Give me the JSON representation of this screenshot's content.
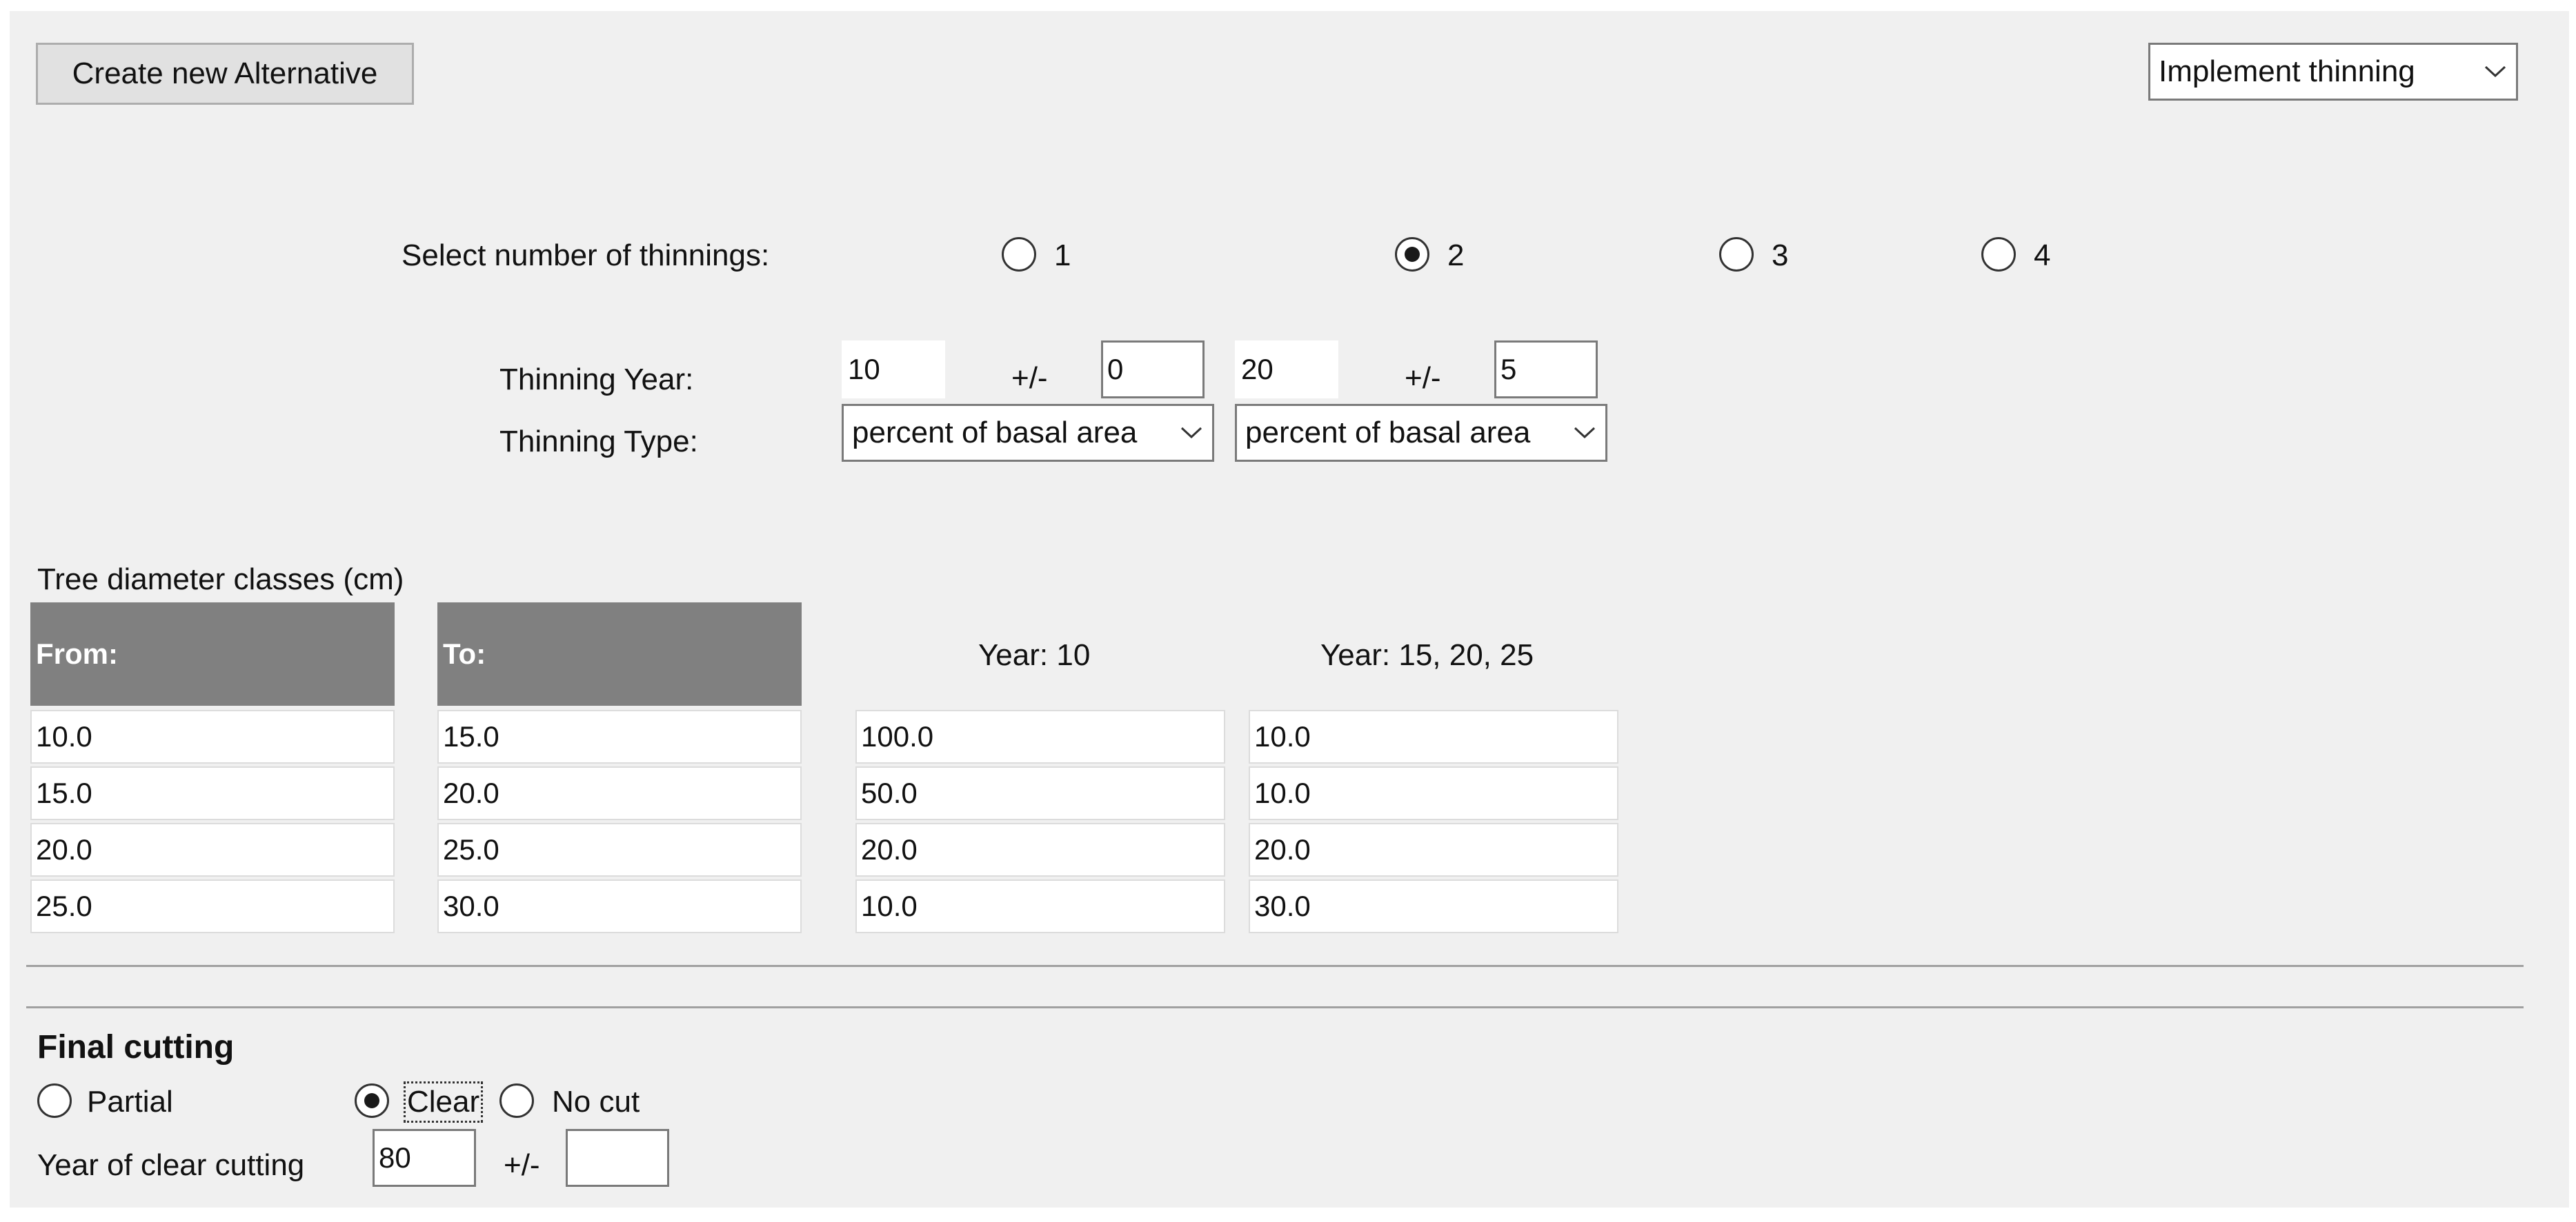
{
  "toolbar": {
    "create_label": "Create new Alternative",
    "mode_select": "Implement thinning"
  },
  "thinnings": {
    "label": "Select number of thinnings:",
    "options": [
      {
        "label": "1",
        "checked": false
      },
      {
        "label": "2",
        "checked": true
      },
      {
        "label": "3",
        "checked": false
      },
      {
        "label": "4",
        "checked": false
      }
    ],
    "year_label": "Thinning Year:",
    "type_label": "Thinning Type:",
    "pm_label": "+/-",
    "years": [
      {
        "year": "10",
        "tolerance": "0",
        "type": "percent of basal area"
      },
      {
        "year": "20",
        "tolerance": "5",
        "type": "percent of basal area"
      }
    ]
  },
  "diameter": {
    "caption": "Tree diameter classes (cm)",
    "from_header": "From:",
    "to_header": "To:",
    "year_headers": [
      "Year: 10",
      "Year: 15, 20, 25"
    ],
    "rows": [
      {
        "from": "10.0",
        "to": "15.0",
        "y1": "100.0",
        "y2": "10.0"
      },
      {
        "from": "15.0",
        "to": "20.0",
        "y1": "50.0",
        "y2": "10.0"
      },
      {
        "from": "20.0",
        "to": "25.0",
        "y1": "20.0",
        "y2": "20.0"
      },
      {
        "from": "25.0",
        "to": "30.0",
        "y1": "10.0",
        "y2": "30.0"
      }
    ]
  },
  "final_cutting": {
    "title": "Final cutting",
    "options": [
      {
        "label": "Partial",
        "checked": false
      },
      {
        "label": "Clear",
        "checked": true
      },
      {
        "label": "No cut",
        "checked": false
      }
    ],
    "year_label": "Year of clear cutting",
    "year_value": "80",
    "pm_label": "+/-",
    "tolerance_value": ""
  }
}
